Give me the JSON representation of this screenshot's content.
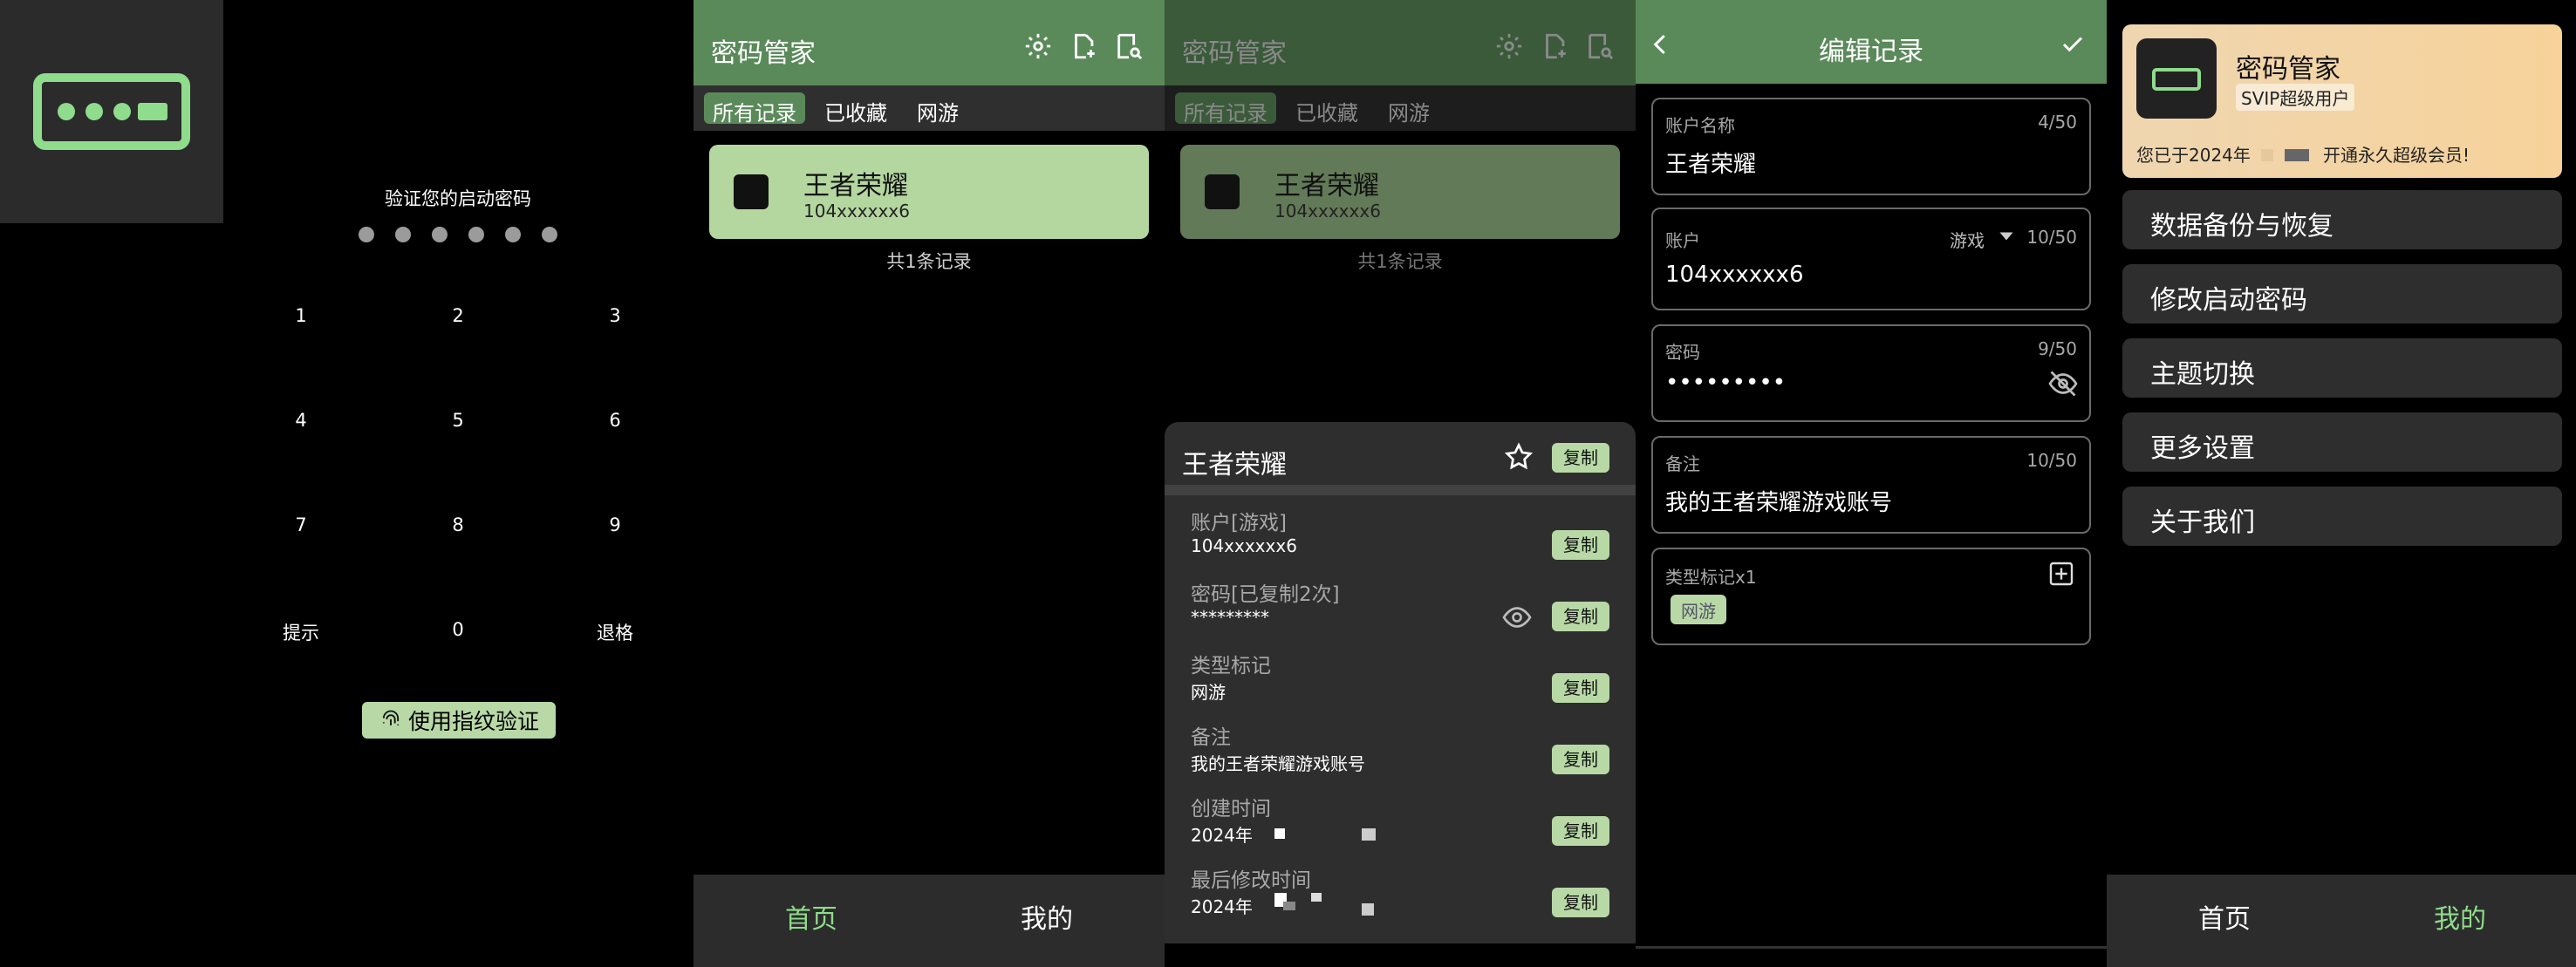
{
  "colors": {
    "accent": "#5b8a5a",
    "accent_light": "#b8d9a6",
    "logo_green": "#8fdc8c",
    "card_green": "#b4d7a0",
    "vip_gold": "#f7d29a"
  },
  "lock_screen": {
    "prompt": "验证您的启动密码",
    "keys": [
      "1",
      "2",
      "3",
      "4",
      "5",
      "6",
      "7",
      "8",
      "9",
      "提示",
      "0",
      "退格"
    ],
    "fingerprint_button": "使用指纹验证",
    "icons": [
      "app-logo-icon",
      "fingerprint-icon"
    ]
  },
  "home": {
    "title": "密码管家",
    "tabs": [
      "所有记录",
      "已收藏",
      "网游"
    ],
    "record": {
      "name": "王者荣耀",
      "account": "104xxxxxx6"
    },
    "count_text": "共1条记录",
    "nav": [
      "首页",
      "我的"
    ],
    "icons": [
      "settings-icon",
      "add-file-icon",
      "search-file-icon",
      "person-card-icon"
    ]
  },
  "detail": {
    "title": "王者荣耀",
    "copy": "复制",
    "fields": [
      {
        "label": "账户[游戏]",
        "value": "104xxxxxx6"
      },
      {
        "label": "密码[已复制2次]",
        "value": "*********"
      },
      {
        "label": "类型标记",
        "value": "网游"
      },
      {
        "label": "备注",
        "value": "我的王者荣耀游戏账号"
      },
      {
        "label": "创建时间",
        "value": "2024年"
      },
      {
        "label": "最后修改时间",
        "value": "2024年"
      }
    ],
    "icons": [
      "star-icon",
      "eye-icon"
    ]
  },
  "edit": {
    "title": "编辑记录",
    "name_label": "账户名称",
    "name_count": "4/50",
    "name_value": "王者荣耀",
    "account_label": "账户",
    "account_type": "游戏",
    "account_count": "10/50",
    "account_value": "104xxxxxx6",
    "password_label": "密码",
    "password_count": "9/50",
    "password_value": "•••••••••",
    "note_label": "备注",
    "note_count": "10/50",
    "note_value": "我的王者荣耀游戏账号",
    "tag_label": "类型标记x1",
    "tag_value": "网游",
    "icons": [
      "back-icon",
      "check-icon",
      "dropdown-icon",
      "eye-off-icon",
      "add-box-icon"
    ]
  },
  "profile": {
    "app_name": "密码管家",
    "badge": "SVIP超级用户",
    "note_prefix": "您已于2024年",
    "note_suffix": "开通永久超级会员!",
    "menu": [
      "数据备份与恢复",
      "修改启动密码",
      "主题切换",
      "更多设置",
      "关于我们"
    ],
    "nav": [
      "首页",
      "我的"
    ]
  }
}
